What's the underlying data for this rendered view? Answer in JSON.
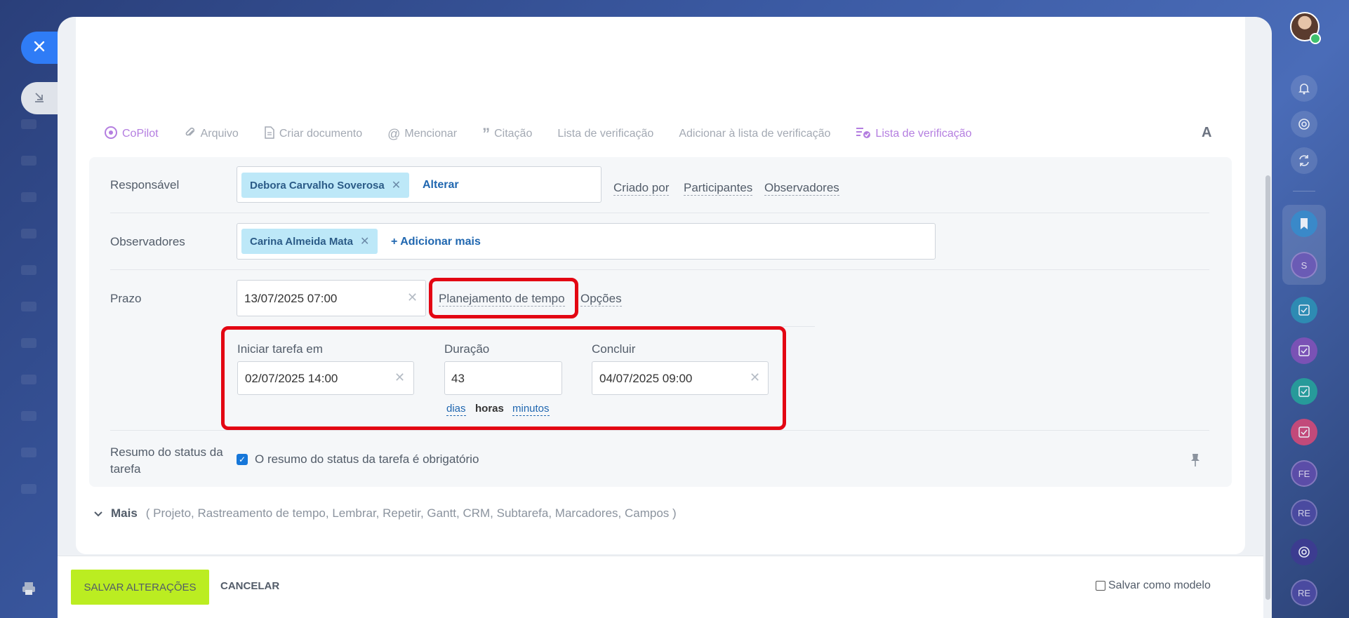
{
  "toolbar": {
    "copilot": "CoPilot",
    "arquivo": "Arquivo",
    "criar_documento": "Criar documento",
    "mencionar": "Mencionar",
    "citacao": "Citação",
    "lista_verificacao": "Lista de verificação",
    "adicionar_lista": "Adicionar à lista de verificação",
    "lista_verificacao_2": "Lista de verificação",
    "font": "A"
  },
  "responsavel": {
    "label": "Responsável",
    "chip": "Debora Carvalho Soverosa",
    "change": "Alterar",
    "links": [
      "Criado por",
      "Participantes",
      "Observadores"
    ]
  },
  "observadores": {
    "label": "Observadores",
    "chip": "Carina Almeida Mata",
    "add_more": "+ Adicionar mais"
  },
  "prazo": {
    "label": "Prazo",
    "value": "13/07/2025 07:00",
    "planning": "Planejamento de tempo",
    "options": "Opções"
  },
  "planning": {
    "start_label": "Iniciar tarefa em",
    "start_value": "02/07/2025 14:00",
    "duration_label": "Duração",
    "duration_value": "43",
    "end_label": "Concluir",
    "end_value": "04/07/2025 09:00",
    "units": [
      "dias",
      "horas",
      "minutos"
    ],
    "active_unit": "horas"
  },
  "status_summary": {
    "label_line1": "Resumo do status da",
    "label_line2": "tarefa",
    "checkbox_label": "O resumo do status da tarefa é obrigatório",
    "checked": true
  },
  "more": {
    "label": "Mais",
    "items": "( Projeto,  Rastreamento de tempo,  Lembrar,  Repetir,  Gantt,  CRM,  Subtarefa,  Marcadores,  Campos )"
  },
  "footer": {
    "save": "SALVAR ALTERAÇÕES",
    "cancel": "CANCELAR",
    "save_template": "Salvar como modelo"
  },
  "sidebar": {
    "avatars": [
      "S",
      "FE",
      "RE",
      "RE"
    ]
  },
  "colors": {
    "accent": "#2f7cf6",
    "save_button": "#bbed21",
    "highlight": "#e30613",
    "chip": "#bde8f8"
  }
}
